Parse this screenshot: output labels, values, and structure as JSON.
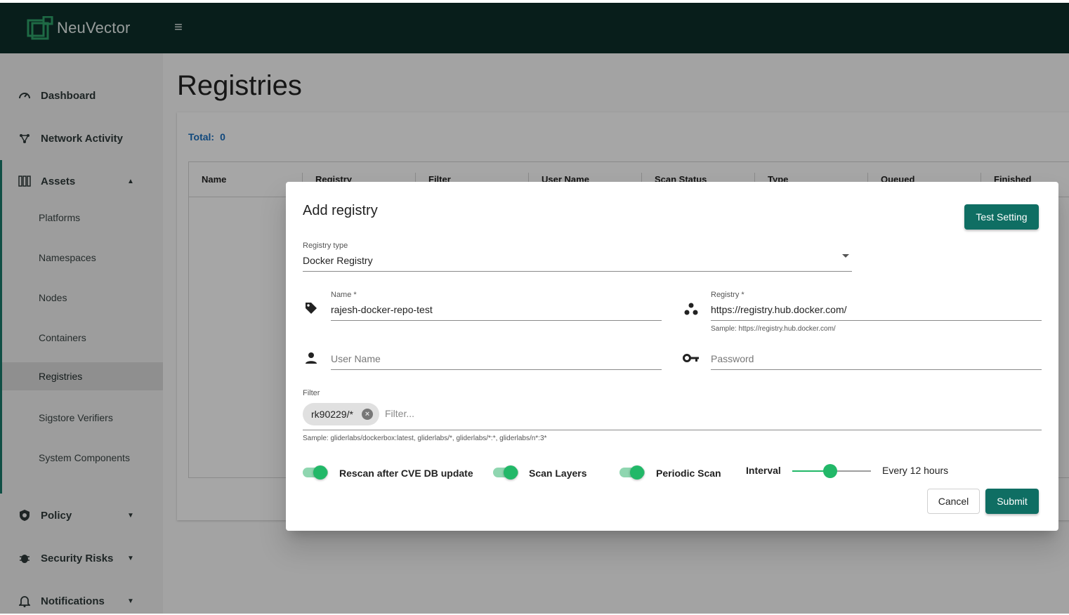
{
  "app": {
    "brand": "NeuVector",
    "menu_icon": "menu-icon"
  },
  "sidebar": {
    "items": [
      {
        "label": "Dashboard",
        "icon": "speedometer-icon"
      },
      {
        "label": "Network Activity",
        "icon": "network-icon"
      },
      {
        "label": "Assets",
        "icon": "grid-icon",
        "expanded": true
      },
      {
        "label": "Policy",
        "icon": "shield-icon"
      },
      {
        "label": "Security Risks",
        "icon": "bug-icon"
      },
      {
        "label": "Notifications",
        "icon": "bell-icon"
      }
    ],
    "assets_children": [
      "Platforms",
      "Namespaces",
      "Nodes",
      "Containers",
      "Registries",
      "Sigstore Verifiers",
      "System Components"
    ],
    "active_child": "Registries"
  },
  "page": {
    "title": "Registries",
    "total_label": "Total:",
    "total_value": "0",
    "columns": [
      "Name",
      "Registry",
      "Filter",
      "User Name",
      "Scan Status",
      "Type",
      "Queued",
      "Finished"
    ]
  },
  "dialog": {
    "title": "Add registry",
    "test_button": "Test Setting",
    "registry_type_label": "Registry type",
    "registry_type_value": "Docker Registry",
    "name_label": "Name *",
    "name_value": "rajesh-docker-repo-test",
    "registry_label": "Registry *",
    "registry_value": "https://registry.hub.docker.com/",
    "registry_hint": "Sample: https://registry.hub.docker.com/",
    "username_placeholder": "User Name",
    "password_placeholder": "Password",
    "filter_label": "Filter",
    "filter_chip": "rk90229/*",
    "filter_placeholder": "Filter...",
    "filter_hint": "Sample: gliderlabs/dockerbox:latest, gliderlabs/*, gliderlabs/*:*, gliderlabs/n*:3*",
    "toggles": [
      {
        "label": "Rescan after CVE DB update",
        "on": true
      },
      {
        "label": "Scan Layers",
        "on": true
      },
      {
        "label": "Periodic Scan",
        "on": true
      }
    ],
    "interval_label": "Interval",
    "interval_value_text": "Every 12 hours",
    "interval_slider_fraction": 0.48,
    "cancel_button": "Cancel",
    "submit_button": "Submit"
  },
  "colors": {
    "topbar": "#0d2f2a",
    "primary": "#0f6e63",
    "toggle_on": "#22b868",
    "link": "#1a6fbf"
  }
}
